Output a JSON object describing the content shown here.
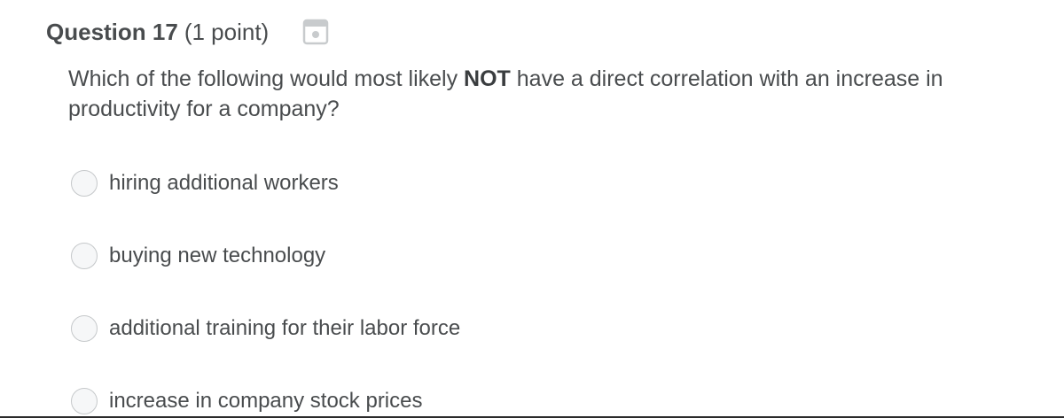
{
  "question": {
    "title": "Question 17",
    "points": "(1 point)",
    "text_before": "Which of the following would most likely ",
    "text_bold": "NOT",
    "text_after": " have a direct correlation with an increase in productivity for a company?",
    "save_icon": "save-icon"
  },
  "choices": [
    {
      "label": "hiring additional workers",
      "selected": false
    },
    {
      "label": "buying new technology",
      "selected": false
    },
    {
      "label": "additional training for their labor force",
      "selected": false
    },
    {
      "label": "increase in company stock prices",
      "selected": false
    }
  ],
  "colors": {
    "text": "#494c4e",
    "radio_border": "#c5c8ca",
    "radio_fill": "#f6f7f8",
    "icon": "#c8cbcd"
  }
}
